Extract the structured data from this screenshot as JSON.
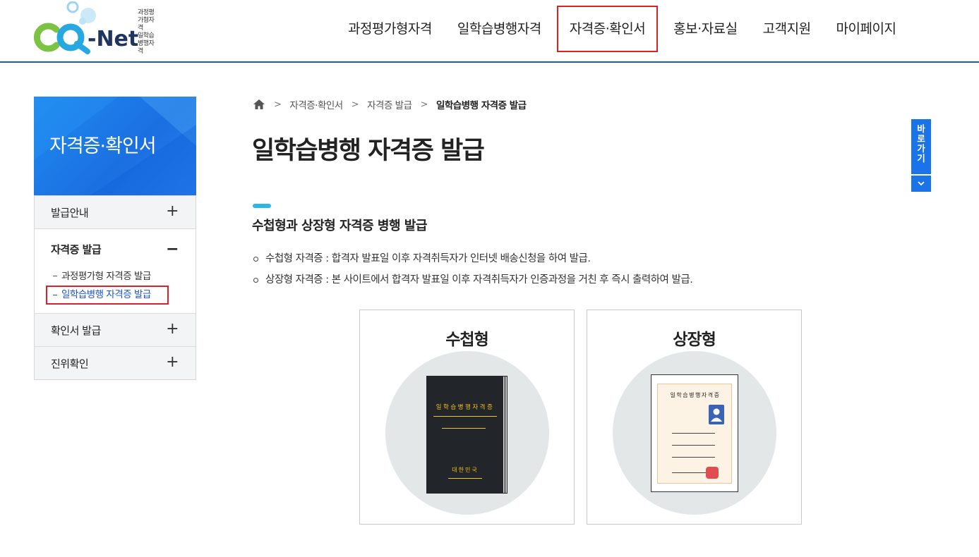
{
  "logo": {
    "sub_line1": "과정평가형자격",
    "sub_line2": "일학습병행자격",
    "wordmark": "-Net",
    "letters": "CQ"
  },
  "gnb": [
    "과정평가형자격",
    "일학습병행자격",
    "자격증·확인서",
    "홍보·자료실",
    "고객지원",
    "마이페이지"
  ],
  "gnb_active_index": 2,
  "side": {
    "title": "자격증·확인서",
    "menu": [
      {
        "label": "발급안내",
        "sign": "+"
      },
      {
        "label": "자격증 발급",
        "sign": "−",
        "children": [
          "과정평가형 자격증 발급",
          "일학습병행 자격증 발급"
        ]
      },
      {
        "label": "확인서 발급",
        "sign": "+"
      },
      {
        "label": "진위확인",
        "sign": "+"
      }
    ]
  },
  "breadcrumb": {
    "home_icon": "home-icon",
    "items": [
      "자격증·확인서",
      "자격증 발급",
      "일학습병행 자격증 발급"
    ],
    "separator": ">"
  },
  "page_title": "일학습병행 자격증 발급",
  "section": {
    "title": "수첩형과 상장형 자격증 병행 발급",
    "bullets": [
      "수첩형 자격증 : 합격자 발표일 이후 자격취득자가 인터넷 배송신청을 하여 발급.",
      "상장형 자격증 : 본 사이트에서 합격자 발표일 이후 자격취득자가 인증과정을 거친 후 즉시 출력하여 발급."
    ]
  },
  "cards": [
    {
      "title": "수첩형",
      "doc_title": "일학습병행자격증",
      "country": "대한민국"
    },
    {
      "title": "상장형",
      "doc_title": "일학습병행자격증"
    }
  ],
  "quick": {
    "label_chars": [
      "바",
      "로",
      "가",
      "기"
    ],
    "down_icon": "chevron-down-icon"
  },
  "colors": {
    "accent_blue": "#1a73e8",
    "highlight_red": "#d8232a",
    "section_bar": "#2cb6e8",
    "book_gold": "#f2c31b"
  }
}
